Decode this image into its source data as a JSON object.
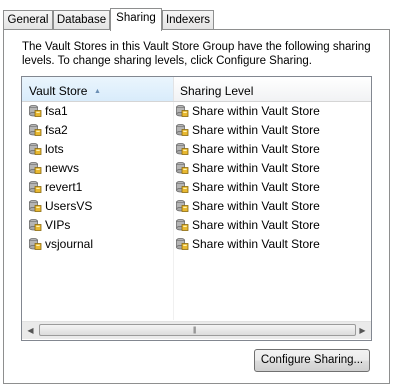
{
  "tabs": [
    {
      "label": "General"
    },
    {
      "label": "Database"
    },
    {
      "label": "Sharing"
    },
    {
      "label": "Indexers"
    }
  ],
  "active_tab": "Sharing",
  "description": "The Vault Stores in this Vault Store Group have the following sharing levels.  To change sharing levels, click Configure Sharing.",
  "list": {
    "columns": [
      "Vault Store",
      "Sharing Level"
    ],
    "sorted_column": "Vault Store",
    "sort_direction": "ascending",
    "rows": [
      {
        "store": "fsa1",
        "level": "Share within Vault Store"
      },
      {
        "store": "fsa2",
        "level": "Share within Vault Store"
      },
      {
        "store": "lots",
        "level": "Share within Vault Store"
      },
      {
        "store": "newvs",
        "level": "Share within Vault Store"
      },
      {
        "store": "revert1",
        "level": "Share within Vault Store"
      },
      {
        "store": "UsersVS",
        "level": "Share within Vault Store"
      },
      {
        "store": "VIPs",
        "level": "Share within Vault Store"
      },
      {
        "store": "vsjournal",
        "level": "Share within Vault Store"
      }
    ],
    "store_icon": "vault-store-icon",
    "level_icon": "sharing-level-icon"
  },
  "configure_button": "Configure Sharing...",
  "colors": {
    "selected_header": "#d9ecfb",
    "border": "#8e8f8f"
  }
}
